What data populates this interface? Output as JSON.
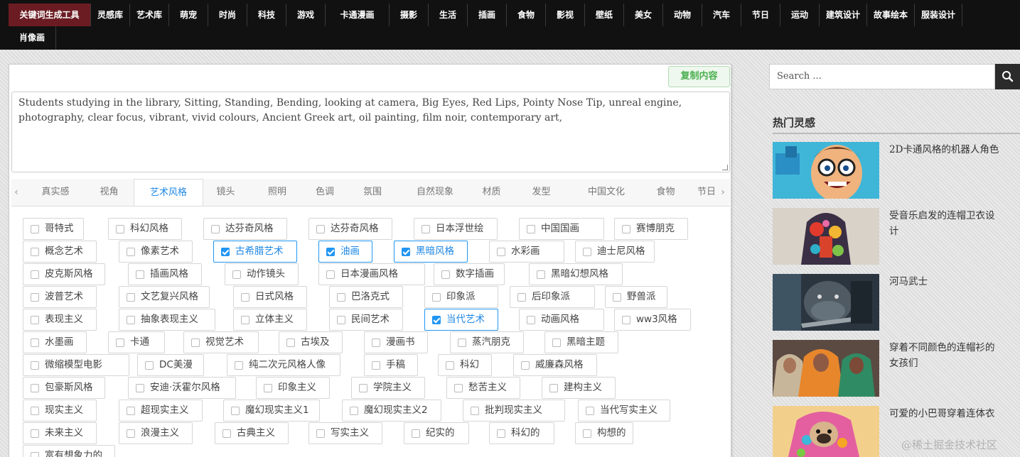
{
  "nav": {
    "items": [
      "关键词生成工具",
      "灵感库",
      "艺术库",
      "萌宠",
      "时尚",
      "科技",
      "游戏",
      "卡通漫画",
      "摄影",
      "生活",
      "插画",
      "食物",
      "影视",
      "壁纸",
      "美女",
      "动物",
      "汽车",
      "节日",
      "运动",
      "建筑设计",
      "故事绘本",
      "服装设计",
      "肖像画"
    ],
    "active_index": 0
  },
  "editor": {
    "copy_label": "复制内容",
    "prompt_text": "Students studying in the library, Sitting, Standing, Bending, looking at camera, Big Eyes, Red Lips, Pointy Nose Tip, unreal engine, photography, clear focus, vibrant, vivid colours, Ancient Greek art, oil painting, film noir, contemporary art,"
  },
  "tabs": {
    "items": [
      "真实感",
      "视角",
      "艺术风格",
      "镜头",
      "照明",
      "色调",
      "氛围",
      "自然现象",
      "材质",
      "发型",
      "中国文化",
      "食物",
      "节日"
    ],
    "active_index": 2,
    "prev_arrow": "‹",
    "next_arrow": "›"
  },
  "options": [
    [
      "哥特式",
      "科幻风格",
      "达芬奇风格",
      "达芬奇风格",
      "日本浮世绘",
      "中国国画",
      "赛博朋克"
    ],
    [
      "概念艺术",
      "像素艺术",
      "古希腊艺术",
      "油画",
      "黑暗风格",
      "水彩画",
      "迪士尼风格"
    ],
    [
      "皮克斯风格",
      "插画风格",
      "动作镜头",
      "日本漫画风格",
      "数字插画",
      "黑暗幻想风格"
    ],
    [
      "波普艺术",
      "文艺复兴风格",
      "日式风格",
      "巴洛克式",
      "印象派",
      "后印象派",
      "野兽派"
    ],
    [
      "表现主义",
      "抽象表现主义",
      "立体主义",
      "民间艺术",
      "当代艺术",
      "动画风格",
      "ww3风格"
    ],
    [
      "水墨画",
      "卡通",
      "视觉艺术",
      "古埃及",
      "漫画书",
      "蒸汽朋克",
      "黑暗主题"
    ],
    [
      "微缩模型电影",
      "DC美漫",
      "纯二次元风格人像",
      "手稿",
      "科幻",
      "威廉森风格"
    ],
    [
      "包豪斯风格",
      "安迪·沃霍尔风格",
      "印象主义",
      "学院主义",
      "愁苦主义",
      "建构主义"
    ],
    [
      "现实主义",
      "超现实主义",
      "魔幻现实主义1",
      "魔幻现实主义2",
      "批判现实主义",
      "当代写实主义"
    ],
    [
      "未来主义",
      "浪漫主义",
      "古典主义",
      "写实主义",
      "纪实的",
      "科幻的",
      "构想的"
    ],
    [
      "富有想象力的"
    ]
  ],
  "checked_options": [
    "古希腊艺术",
    "油画",
    "黑暗风格",
    "当代艺术"
  ],
  "sidebar": {
    "search_placeholder": "Search ...",
    "widget_title": "热门灵感",
    "posts": [
      {
        "title": "2D卡通风格的机器人角色"
      },
      {
        "title": "受音乐启发的连帽卫衣设计"
      },
      {
        "title": "河马武士"
      },
      {
        "title": "穿着不同颜色的连帽衫的女孩们"
      },
      {
        "title": "可爱的小巴哥穿着连体衣"
      }
    ]
  },
  "watermark": "@稀土掘金技术社区",
  "colors": {
    "nav_bg": "#111111",
    "nav_active": "#6b1c22",
    "accent": "#1e88e5",
    "copy_green": "#4caf50"
  }
}
